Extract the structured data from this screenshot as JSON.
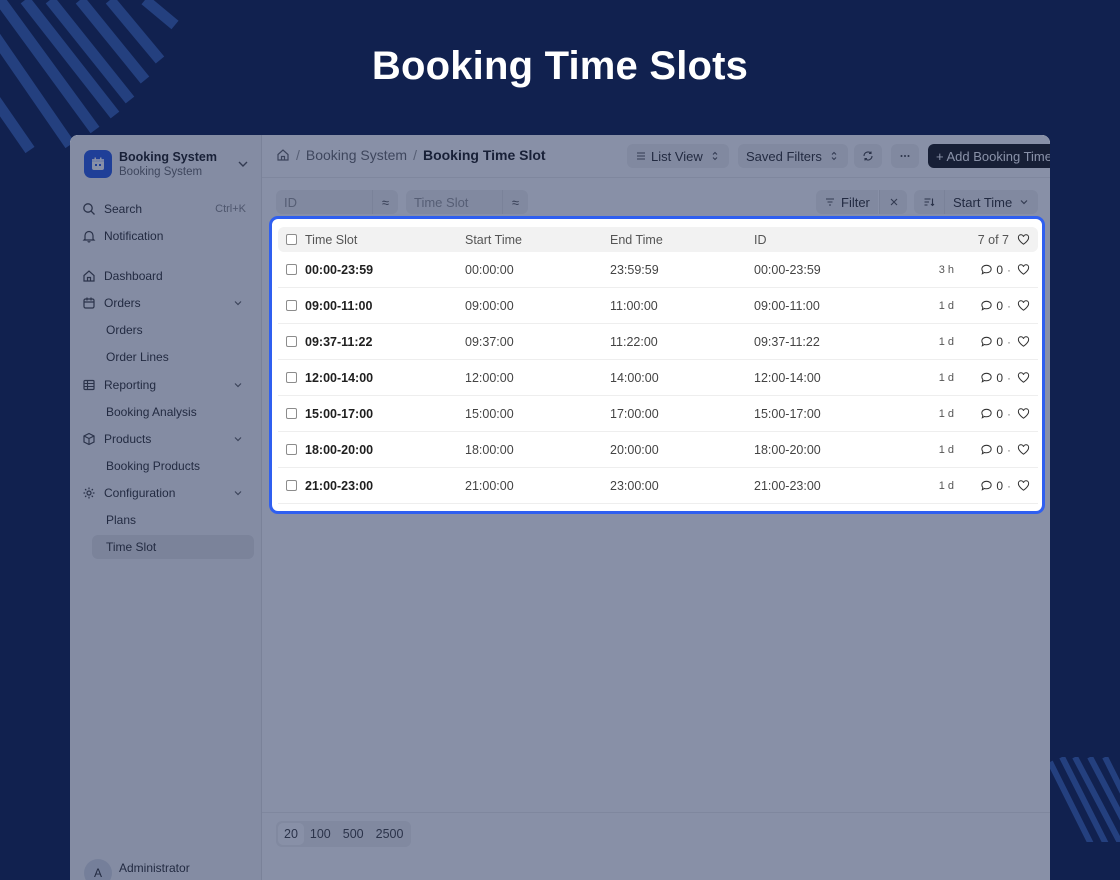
{
  "page": {
    "title": "Booking Time Slots"
  },
  "sidebar": {
    "app_name": "Booking System",
    "app_sub": "Booking System",
    "search_label": "Search",
    "search_shortcut": "Ctrl+K",
    "notification_label": "Notification",
    "items": [
      {
        "label": "Dashboard"
      },
      {
        "label": "Orders",
        "children": [
          "Orders",
          "Order Lines"
        ]
      },
      {
        "label": "Reporting",
        "children": [
          "Booking Analysis"
        ]
      },
      {
        "label": "Products",
        "children": [
          "Booking Products"
        ]
      },
      {
        "label": "Configuration",
        "children": [
          "Plans",
          "Time Slot"
        ]
      }
    ],
    "active_item": "Time Slot",
    "user": {
      "initial": "A",
      "name": "Administrator"
    }
  },
  "breadcrumb": [
    "Booking System",
    "Booking Time Slot"
  ],
  "toolbar": {
    "list_view_label": "List View",
    "saved_filters_label": "Saved Filters",
    "add_label": "+ Add Booking Time Slot"
  },
  "filters": {
    "id_placeholder": "ID",
    "time_slot_placeholder": "Time Slot",
    "approx_symbol": "≈",
    "filter_label": "Filter",
    "sort_label": "Start Time"
  },
  "list": {
    "columns": [
      "Time Slot",
      "Start Time",
      "End Time",
      "ID"
    ],
    "count_label": "7 of 7",
    "rows": [
      {
        "slot": "00:00-23:59",
        "start": "00:00:00",
        "end": "23:59:59",
        "id": "00:00-23:59",
        "age": "3 h",
        "comments": "0"
      },
      {
        "slot": "09:00-11:00",
        "start": "09:00:00",
        "end": "11:00:00",
        "id": "09:00-11:00",
        "age": "1 d",
        "comments": "0"
      },
      {
        "slot": "09:37-11:22",
        "start": "09:37:00",
        "end": "11:22:00",
        "id": "09:37-11:22",
        "age": "1 d",
        "comments": "0"
      },
      {
        "slot": "12:00-14:00",
        "start": "12:00:00",
        "end": "14:00:00",
        "id": "12:00-14:00",
        "age": "1 d",
        "comments": "0"
      },
      {
        "slot": "15:00-17:00",
        "start": "15:00:00",
        "end": "17:00:00",
        "id": "15:00-17:00",
        "age": "1 d",
        "comments": "0"
      },
      {
        "slot": "18:00-20:00",
        "start": "18:00:00",
        "end": "20:00:00",
        "id": "18:00-20:00",
        "age": "1 d",
        "comments": "0"
      },
      {
        "slot": "21:00-23:00",
        "start": "21:00:00",
        "end": "23:00:00",
        "id": "21:00-23:00",
        "age": "1 d",
        "comments": "0"
      }
    ]
  },
  "pager": {
    "sizes": [
      "20",
      "100",
      "500",
      "2500"
    ],
    "selected": "20"
  },
  "colors": {
    "background": "#11214f",
    "highlight": "#2f5ff0",
    "brand": "#2c5ce0"
  }
}
